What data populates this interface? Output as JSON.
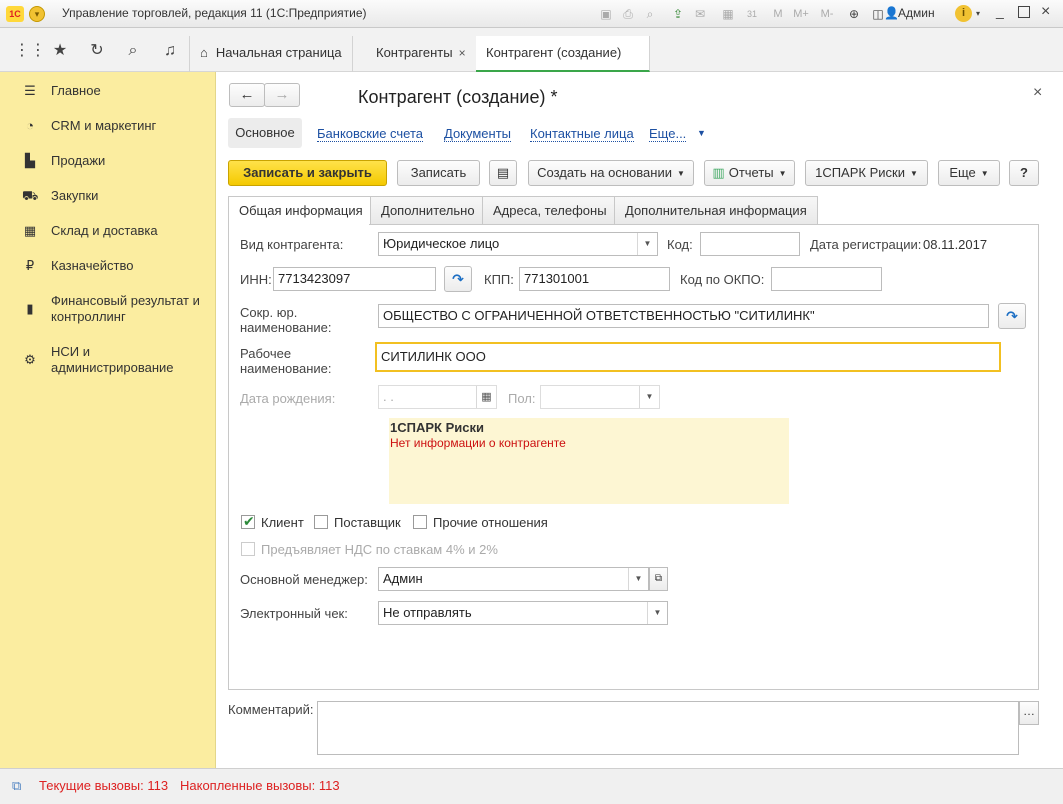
{
  "window": {
    "logo": "1С",
    "title": "Управление торговлей, редакция 11  (1С:Предприятие)",
    "user": "Админ",
    "zoom_buttons": [
      "M",
      "M+",
      "M-"
    ]
  },
  "nav": {
    "tabs": [
      {
        "label": "Начальная страница",
        "closable": false
      },
      {
        "label": "Контрагенты",
        "closable": true
      },
      {
        "label": "Контрагент (создание) *",
        "closable": true
      }
    ],
    "close_glyph": "×"
  },
  "sidebar": {
    "items": [
      {
        "label": "Главное",
        "icon": "menu-lines-icon"
      },
      {
        "label": "CRM и маркетинг",
        "icon": "pie-chart-icon"
      },
      {
        "label": "Продажи",
        "icon": "shopping-bag-icon"
      },
      {
        "label": "Закупки",
        "icon": "cart-icon"
      },
      {
        "label": "Склад и доставка",
        "icon": "grid-icon"
      },
      {
        "label": "Казначейство",
        "icon": "ruble-coin-icon"
      },
      {
        "label": "Финансовый результат и контроллинг",
        "icon": "bar-chart-icon"
      },
      {
        "label": "НСИ и администрирование",
        "icon": "gear-icon"
      }
    ]
  },
  "form": {
    "title": "Контрагент (создание) *",
    "sections": {
      "main": "Основное",
      "bank": "Банковские счета",
      "docs": "Документы",
      "contacts": "Контактные лица",
      "more": "Еще..."
    },
    "toolbar": {
      "save_close": "Записать и закрыть",
      "save": "Записать",
      "create_based": "Создать на основании",
      "reports": "Отчеты",
      "spark": "1СПАРК Риски",
      "more": "Еще",
      "help": "?"
    },
    "tabs": [
      "Общая информация",
      "Дополнительно",
      "Адреса, телефоны",
      "Дополнительная информация"
    ],
    "fields": {
      "type_label": "Вид контрагента:",
      "type_value": "Юридическое лицо",
      "code_label": "Код:",
      "code_value": "",
      "reg_date_label": "Дата регистрации:",
      "reg_date_value": "08.11.2017",
      "inn_label": "ИНН:",
      "inn_value": "7713423097",
      "kpp_label": "КПП:",
      "kpp_value": "771301001",
      "okpo_label": "Код по ОКПО:",
      "okpo_value": "",
      "short_name_label": "Сокр. юр. наименование:",
      "short_name_value": "ОБЩЕСТВО С ОГРАНИЧЕННОЙ ОТВЕТСТВЕННОСТЬЮ \"СИТИЛИНК\"",
      "work_name_label": "Рабочее наименование:",
      "work_name_value": "СИТИЛИНК ООО",
      "birth_label": "Дата рождения:",
      "birth_value": " .  .",
      "gender_label": "Пол:",
      "gender_value": "",
      "manager_label": "Основной менеджер:",
      "manager_value": "Админ",
      "echeck_label": "Электронный чек:",
      "echeck_value": "Не отправлять",
      "comment_label": "Комментарий:",
      "comment_value": ""
    },
    "spark_panel": {
      "title": "1СПАРК Риски",
      "message": "Нет информации о контрагенте",
      "bg": "#fdf6d3",
      "message_color": "#cc1111"
    },
    "checkboxes": {
      "client": {
        "label": "Клиент",
        "checked": true
      },
      "supplier": {
        "label": "Поставщик",
        "checked": false
      },
      "other": {
        "label": "Прочие отношения",
        "checked": false
      },
      "vat": {
        "label": "Предъявляет НДС по ставкам 4% и 2%",
        "checked": false
      }
    }
  },
  "status": {
    "current": "Текущие вызовы: 113",
    "accumulated": "Накопленные вызовы: 113"
  },
  "colors": {
    "sidebar": "#fbeda0",
    "primary_button": "#f4c900",
    "link": "#1d50a2",
    "active_tab_underline": "#3aa64a",
    "status_text": "#dd2222"
  }
}
